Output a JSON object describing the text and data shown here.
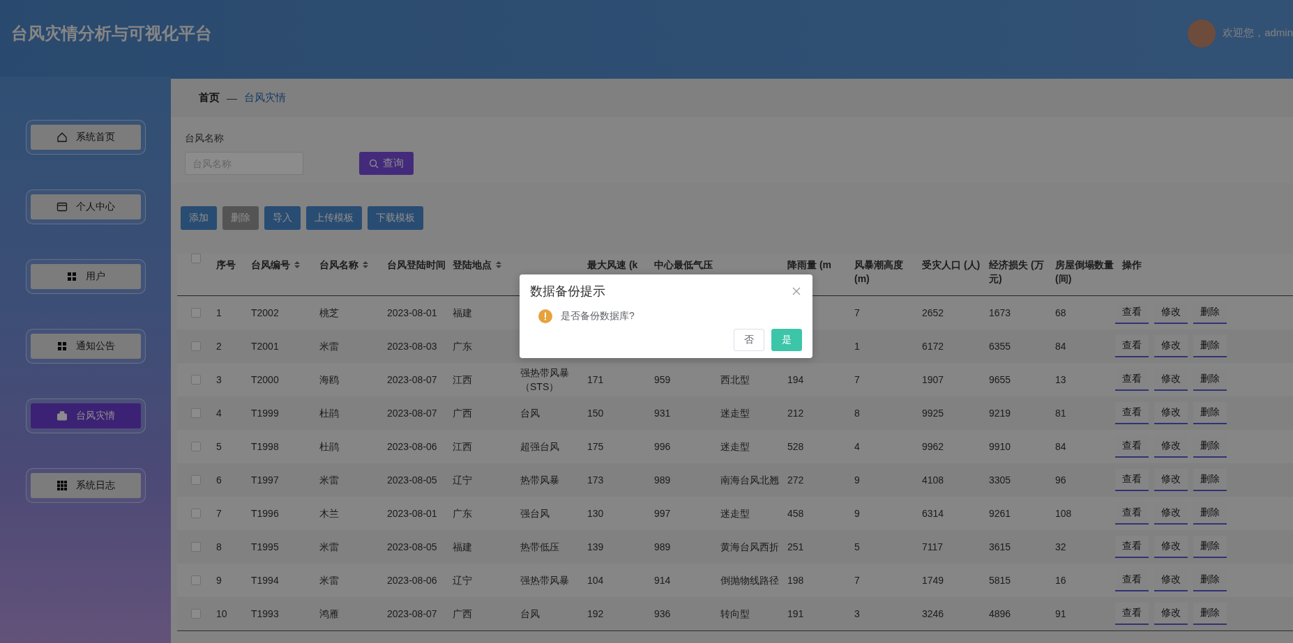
{
  "header": {
    "title": "台风灾情分析与可视化平台",
    "welcome": "欢迎您，admin"
  },
  "sidebar": {
    "items": [
      {
        "label": "系统首页",
        "selected": false
      },
      {
        "label": "个人中心",
        "selected": false
      },
      {
        "label": "用户",
        "selected": false
      },
      {
        "label": "通知公告",
        "selected": false
      },
      {
        "label": "台风灾情",
        "selected": true
      },
      {
        "label": "系统日志",
        "selected": false
      }
    ]
  },
  "breadcrumb": {
    "items": [
      {
        "label": "首页",
        "current": false
      },
      {
        "label": "台风灾情",
        "current": true
      }
    ],
    "separator": "—"
  },
  "search": {
    "label": "台风名称",
    "placeholder": "台风名称",
    "button": "查询"
  },
  "toolbar": [
    {
      "label": "添加",
      "disabled": false
    },
    {
      "label": "删除",
      "disabled": true
    },
    {
      "label": "导入",
      "disabled": false
    },
    {
      "label": "上传模板",
      "disabled": false
    },
    {
      "label": "下载模板",
      "disabled": false
    }
  ],
  "table": {
    "select_all_checked": false,
    "columns": [
      {
        "label": "序号",
        "sortable": false
      },
      {
        "label": "台风编号",
        "sortable": true
      },
      {
        "label": "台风名称",
        "sortable": true
      },
      {
        "label": "台风登陆时间",
        "sortable": false
      },
      {
        "label": "登陆地点",
        "sortable": true
      },
      {},
      {
        "label": "最大风速 (k",
        "sortable": false
      },
      {
        "label": "中心最低气压",
        "sortable": false
      },
      {},
      {
        "label": "降雨量 (m",
        "sortable": false
      },
      {
        "label": "风暴潮高度 (m)",
        "sortable": false
      },
      {
        "label": "受灾人口 (人)",
        "sortable": false
      },
      {
        "label": "经济损失 (万元)",
        "sortable": false
      },
      {
        "label": "房屋倒塌数量 (间)",
        "sortable": false
      },
      {
        "label": "操作",
        "sortable": false
      }
    ],
    "rows": [
      {
        "checked": false,
        "cells": [
          "1",
          "T2002",
          "桃芝",
          "2023-08-01",
          "福建",
          null,
          null,
          null,
          null,
          null,
          "7",
          "2652",
          "1673",
          "68"
        ],
        "actions": [
          "查看",
          "修改",
          "删除"
        ]
      },
      {
        "checked": false,
        "cells": [
          "2",
          "T2001",
          "米雷",
          "2023-08-03",
          "广东",
          null,
          null,
          null,
          null,
          null,
          "1",
          "6172",
          "6355",
          "84"
        ],
        "actions": [
          "查看",
          "修改",
          "删除"
        ]
      },
      {
        "checked": false,
        "cells": [
          "3",
          "T2000",
          "海鸥",
          "2023-08-07",
          "江西",
          "强热带风暴（STS）",
          "171",
          "959",
          "西北型",
          "194",
          "7",
          "1907",
          "9655",
          "13"
        ],
        "actions": [
          "查看",
          "修改",
          "删除"
        ]
      },
      {
        "checked": false,
        "cells": [
          "4",
          "T1999",
          "杜鹃",
          "2023-08-07",
          "广西",
          "台风",
          "150",
          "931",
          "迷走型",
          "212",
          "8",
          "9925",
          "9219",
          "81"
        ],
        "actions": [
          "查看",
          "修改",
          "删除"
        ]
      },
      {
        "checked": false,
        "cells": [
          "5",
          "T1998",
          "杜鹃",
          "2023-08-06",
          "江西",
          "超强台风",
          "175",
          "996",
          "迷走型",
          "528",
          "4",
          "9962",
          "9910",
          "84"
        ],
        "actions": [
          "查看",
          "修改",
          "删除"
        ]
      },
      {
        "checked": false,
        "cells": [
          "6",
          "T1997",
          "米雷",
          "2023-08-05",
          "辽宁",
          "热带风暴",
          "173",
          "989",
          "南海台风北翘",
          "272",
          "9",
          "4108",
          "3305",
          "96"
        ],
        "actions": [
          "查看",
          "修改",
          "删除"
        ]
      },
      {
        "checked": false,
        "cells": [
          "7",
          "T1996",
          "木兰",
          "2023-08-01",
          "广东",
          "强台风",
          "130",
          "997",
          "迷走型",
          "458",
          "9",
          "6314",
          "9261",
          "108"
        ],
        "actions": [
          "查看",
          "修改",
          "删除"
        ]
      },
      {
        "checked": false,
        "cells": [
          "8",
          "T1995",
          "米雷",
          "2023-08-05",
          "福建",
          "热带低压",
          "139",
          "989",
          "黄海台风西折",
          "251",
          "5",
          "7117",
          "3615",
          "32"
        ],
        "actions": [
          "查看",
          "修改",
          "删除"
        ]
      },
      {
        "checked": false,
        "cells": [
          "9",
          "T1994",
          "米雷",
          "2023-08-06",
          "辽宁",
          "强热带风暴",
          "104",
          "914",
          "倒抛物线路径",
          "198",
          "7",
          "1749",
          "5815",
          "16"
        ],
        "actions": [
          "查看",
          "修改",
          "删除"
        ]
      },
      {
        "checked": false,
        "cells": [
          "10",
          "T1993",
          "鸿雁",
          "2023-08-07",
          "广西",
          "台风",
          "192",
          "936",
          "转向型",
          "191",
          "3",
          "3246",
          "4896",
          "91"
        ],
        "actions": [
          "查看",
          "修改",
          "删除"
        ]
      }
    ]
  },
  "dialog": {
    "title": "数据备份提示",
    "message": "是否备份数据库?",
    "buttons": [
      {
        "label": "否",
        "primary": false
      },
      {
        "label": "是",
        "primary": true
      }
    ]
  }
}
